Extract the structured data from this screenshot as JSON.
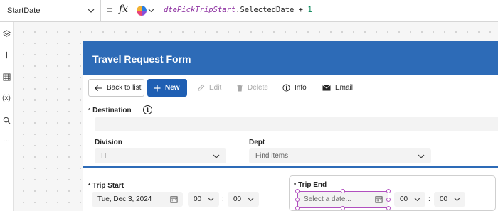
{
  "formula_bar": {
    "property": "StartDate",
    "equals": "=",
    "fx": "fx",
    "formula_control": "dtePickTripStart",
    "formula_rest": ".SelectedDate + ",
    "formula_number": "1"
  },
  "rail": {
    "icons": [
      "layers-icon",
      "plus-icon",
      "data-grid-icon",
      "variables-icon",
      "search-icon",
      "more-icon"
    ],
    "variables_glyph": "(x)",
    "more_glyph": "···"
  },
  "app": {
    "title": "Travel Request Form",
    "header_color": "#2d6bb7",
    "toolbar": {
      "back_label": "Back to list",
      "new_label": "New",
      "edit_label": "Edit",
      "delete_label": "Delete",
      "info_label": "Info",
      "email_label": "Email"
    },
    "form": {
      "destination_label": "Destination",
      "destination_value": "",
      "destination_info": "i",
      "required_mark": "*",
      "division_label": "Division",
      "division_value": "IT",
      "dept_label": "Dept",
      "dept_placeholder": "Find items",
      "trip_start_label": "Trip Start",
      "trip_start_date": "Tue, Dec 3, 2024",
      "trip_start_hour": "00",
      "trip_start_minute": "00",
      "trip_end_label": "Trip End",
      "trip_end_placeholder": "Select a date...",
      "trip_end_hour": "00",
      "trip_end_minute": "00",
      "time_separator": ":"
    }
  },
  "colors": {
    "accent": "#2d6bb7",
    "primary_button": "#1f5fb3",
    "selection": "#b14fbf"
  }
}
